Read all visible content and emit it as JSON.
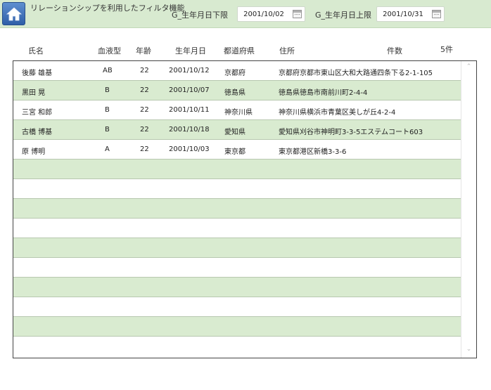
{
  "header": {
    "title": "リレーションシップを利用したフィルタ機能",
    "filter_lower_label": "G_生年月日下限",
    "filter_lower_value": "2001/10/02",
    "filter_upper_label": "G_生年月日上限",
    "filter_upper_value": "2001/10/31"
  },
  "columns": {
    "name": "氏名",
    "blood": "血液型",
    "age": "年齢",
    "birth": "生年月日",
    "pref": "都道府県",
    "address": "住所",
    "count_label": "件数"
  },
  "record_count": "5件",
  "rows": [
    {
      "name": "後藤 雄基",
      "blood": "AB",
      "age": "22",
      "birth": "2001/10/12",
      "pref": "京都府",
      "address": "京都府京都市東山区大和大路通四条下る2-1-105"
    },
    {
      "name": "黒田 晃",
      "blood": "B",
      "age": "22",
      "birth": "2001/10/07",
      "pref": "徳島県",
      "address": "徳島県徳島市南前川町2-4-4"
    },
    {
      "name": "三宮 和郎",
      "blood": "B",
      "age": "22",
      "birth": "2001/10/11",
      "pref": "神奈川県",
      "address": "神奈川県横浜市青葉区美しが丘4-2-4"
    },
    {
      "name": "古橋 博基",
      "blood": "B",
      "age": "22",
      "birth": "2001/10/18",
      "pref": "愛知県",
      "address": "愛知県刈谷市神明町3-3-5エステムコート603"
    },
    {
      "name": "原 博明",
      "blood": "A",
      "age": "22",
      "birth": "2001/10/03",
      "pref": "東京都",
      "address": "東京都港区新橋3-3-6"
    }
  ],
  "icons": {
    "home": "home-icon",
    "calendar": "calendar-icon",
    "scroll_up": "chevron-up-icon",
    "scroll_down": "chevron-down-icon"
  },
  "colors": {
    "header_bg": "#d8ead0",
    "row_alt": "#d9ebd0",
    "home_button": "#3f6fb8"
  }
}
